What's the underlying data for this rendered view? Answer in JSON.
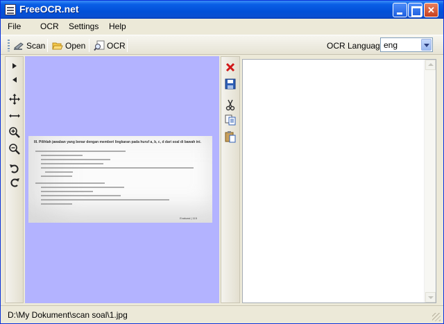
{
  "window": {
    "title": "FreeOCR.net"
  },
  "menu": {
    "items": [
      "File",
      "OCR",
      "Settings",
      "Help"
    ]
  },
  "toolbar": {
    "scan_label": "Scan",
    "open_label": "Open",
    "ocr_label": "OCR",
    "language_label": "OCR Language",
    "language_value": "eng"
  },
  "left_tools": [
    "next-icon",
    "previous-icon",
    "pan-icon",
    "fit-width-icon",
    "zoom-in-icon",
    "zoom-out-icon",
    "rotate-left-icon",
    "rotate-right-icon"
  ],
  "middle_tools": [
    "delete-icon",
    "save-icon",
    "cut-icon",
    "copy-icon",
    "paste-icon"
  ],
  "scan_document": {
    "header": "III. Pilihlah jawaban yang benar dengan memberi lingkaran pada huruf a, b, c, d dari soal di bawah ini.",
    "page_marker": "Evaluasi | 115"
  },
  "status": {
    "path": "D:\\My Dokument\\scan soal\\1.jpg"
  },
  "colors": {
    "image_panel_bg": "#b3b3ff",
    "title_bar": "#0a5fe6"
  }
}
